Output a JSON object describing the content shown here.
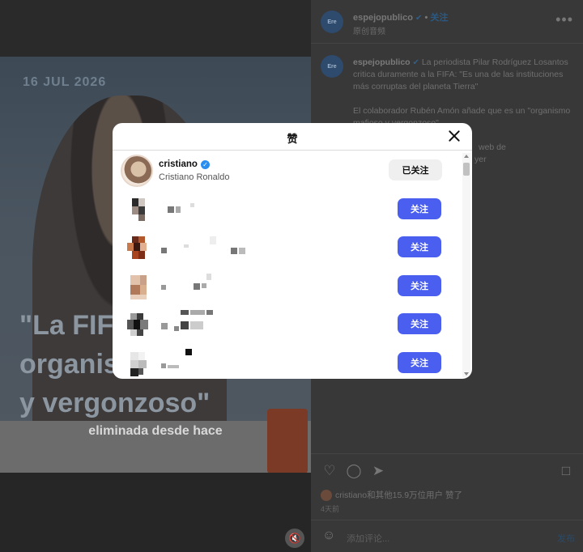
{
  "post": {
    "date_overlay": "16 JUL 2026",
    "headline_overlay": "\"La FIF\norganis\ny vergonzoso\"",
    "caption_overlay": "eliminada desde hace",
    "author": "espejopublico",
    "author_avatar_text": "Ere",
    "follow_label": "关注",
    "audio_label": "原创音频",
    "caption_text": "La periodista Pilar Rodríguez Losantos critica duramente a la FIFA: \"Es una de las instituciones más corruptas del planeta Tierra\"",
    "caption_text_2": "El colaborador Rubén Amón añade que es un \"organismo mafioso y vergonzoso\"",
    "caption_text_3": "web de",
    "caption_text_4": "yer",
    "likes_text": "cristiano和其他15.9万位用户 赞了",
    "time_ago": "4天前",
    "comment_placeholder": "添加评论...",
    "post_button": "发布"
  },
  "modal": {
    "title": "赞",
    "users": [
      {
        "username": "cristiano",
        "fullname": "Cristiano Ronaldo",
        "verified": true,
        "button": "已关注"
      },
      {
        "username": "",
        "fullname": "",
        "verified": false,
        "button": "关注"
      },
      {
        "username": "",
        "fullname": "",
        "verified": false,
        "button": "关注"
      },
      {
        "username": "",
        "fullname": "",
        "verified": false,
        "button": "关注"
      },
      {
        "username": "",
        "fullname": "",
        "verified": false,
        "button": "关注"
      },
      {
        "username": "",
        "fullname": "",
        "verified": false,
        "button": "关注"
      }
    ]
  },
  "colors": {
    "follow_button": "#4a5ff0",
    "following_button": "#efefef",
    "verified": "#2a8df0"
  }
}
